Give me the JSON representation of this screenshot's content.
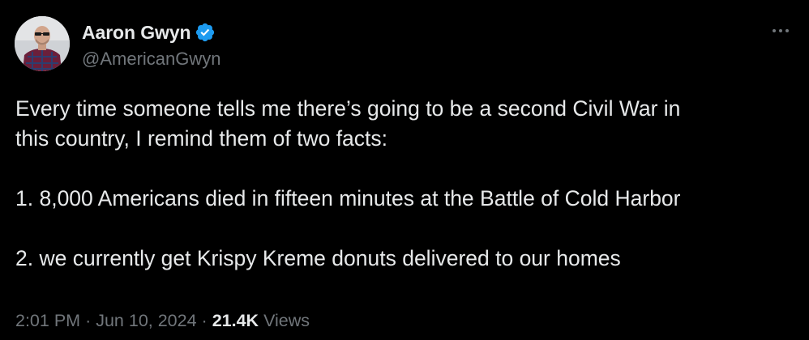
{
  "author": {
    "display_name": "Aaron Gwyn",
    "handle": "@AmericanGwyn",
    "verified_icon": "verified-badge-icon",
    "verified_color": "#1d9bf0"
  },
  "tweet": {
    "lines": [
      "Every time someone tells me there’s going to be a second Civil War in",
      "this country, I remind them of two facts:",
      "1. 8,000 Americans died in fifteen minutes at the Battle of Cold Harbor",
      "2. we currently get Krispy Kreme donuts delivered to our homes"
    ]
  },
  "meta": {
    "time": "2:01 PM",
    "separator": "·",
    "date": "Jun 10, 2024",
    "views_count": "21.4K",
    "views_label": "Views"
  },
  "colors": {
    "background": "#000000",
    "text_primary": "#e7e9ea",
    "text_secondary": "#71767b"
  }
}
